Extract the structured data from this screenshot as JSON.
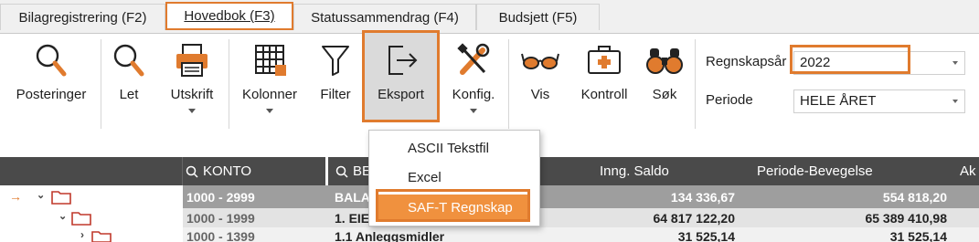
{
  "tabs": [
    {
      "label": "Bilagregistrering (F2)"
    },
    {
      "label": "Hovedbok (F3)"
    },
    {
      "label": "Statussammendrag (F4)"
    },
    {
      "label": "Budsjett (F5)"
    }
  ],
  "toolbar": {
    "posteringer": "Posteringer",
    "let": "Let",
    "utskrift": "Utskrift",
    "kolonner": "Kolonner",
    "filter": "Filter",
    "eksport": "Eksport",
    "konfig": "Konfig.",
    "vis": "Vis",
    "kontroll": "Kontroll",
    "sok": "Søk"
  },
  "fields": {
    "year_label": "Regnskapsår",
    "year_value": "2022",
    "period_label": "Periode",
    "period_value": "HELE ÅRET"
  },
  "grid": {
    "headers": {
      "konto": "KONTO",
      "b": "BE",
      "inng_saldo": "Inng. Saldo",
      "periode_bevegelse": "Periode-Bevegelse",
      "ak": "Ak"
    },
    "rows": [
      {
        "konto": "1000 - 2999",
        "name": "BALA",
        "inng": "134 336,67",
        "bev": "554 818,20"
      },
      {
        "konto": "1000 - 1999",
        "name": "1. EIE",
        "inng": "64 817 122,20",
        "bev": "65 389 410,98"
      },
      {
        "konto": "1000 - 1399",
        "name": "1.1 Anleggsmidler",
        "inng": "31 525,14",
        "bev": "31 525,14"
      }
    ]
  },
  "export_menu": {
    "items": [
      "ASCII Tekstfil",
      "Excel",
      "SAF-T Regnskap"
    ]
  },
  "colors": {
    "accent": "#e07b2e",
    "menu_selected": "#f0913e",
    "grid_header": "#4a4a4a"
  }
}
